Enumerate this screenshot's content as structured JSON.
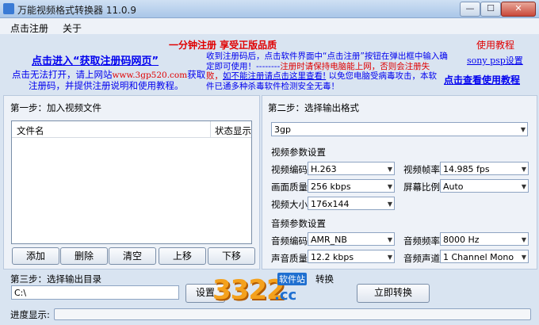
{
  "window": {
    "title": "万能视频格式转换器 11.0.9",
    "min": "—",
    "max": "☐",
    "close": "✕"
  },
  "menu": [
    "点击注册",
    "关于"
  ],
  "promo": {
    "slogan": "一分钟注册 享受正版品质",
    "tutorial": "使用教程",
    "get_code": "点击进入“获取注册码网页”",
    "cant_open_1": "点击无法打开，请上网站",
    "site": "www.3gp520.com",
    "cant_open_2": "获取",
    "cant_open_3": "注册码，并提供注册说明和使用教程。",
    "notice_1": "收到注册码后，点击软件界面中“点击注册”按钮在弹出框中输入确",
    "notice_2": "定即可使用！--------",
    "notice_red_1": "注册时请保持电脑能上网，否则会注册失",
    "notice_red_2": "败，",
    "notice_link": "如不能注册请点击这里查看!",
    "notice_3": "以免您电脑受病毒攻击，本软",
    "notice_4": "件已通多种杀毒软件检测安全无毒！",
    "sony": "sony psp设置",
    "view_tutorial": "点击查看使用教程"
  },
  "step1": {
    "title": "第一步：加入视频文件",
    "col_filename": "文件名",
    "col_status": "状态显示",
    "buttons": [
      "添加",
      "删除",
      "清空",
      "上移",
      "下移"
    ]
  },
  "step2": {
    "title": "第二步：选择输出格式",
    "format": "3gp",
    "video_group": "视频参数设置",
    "video_codec_label": "视频编码",
    "video_codec": "H.263",
    "frame_rate_label": "视频帧率",
    "frame_rate": "14.985 fps",
    "quality_label": "画面质量",
    "quality": "256 kbps",
    "aspect_label": "屏幕比例",
    "aspect": "Auto",
    "size_label": "视频大小",
    "size": "176x144",
    "audio_group": "音频参数设置",
    "audio_codec_label": "音频编码",
    "audio_codec": "AMR_NB",
    "sample_rate_label": "音频频率",
    "sample_rate": "8000 Hz",
    "audio_quality_label": "声音质量",
    "audio_quality": "12.2 kbps",
    "channel_label": "音频声道",
    "channel": "1 Channel Mono"
  },
  "step3": {
    "title": "第三步：选择输出目录",
    "path": "C:\\",
    "set_button": "设置"
  },
  "step4": {
    "title_partial": "转换",
    "convert_button": "立即转换"
  },
  "progress_label": "进度显示:",
  "watermark": {
    "number": "3322",
    "suffix": ".cc",
    "tag": "软件站"
  }
}
